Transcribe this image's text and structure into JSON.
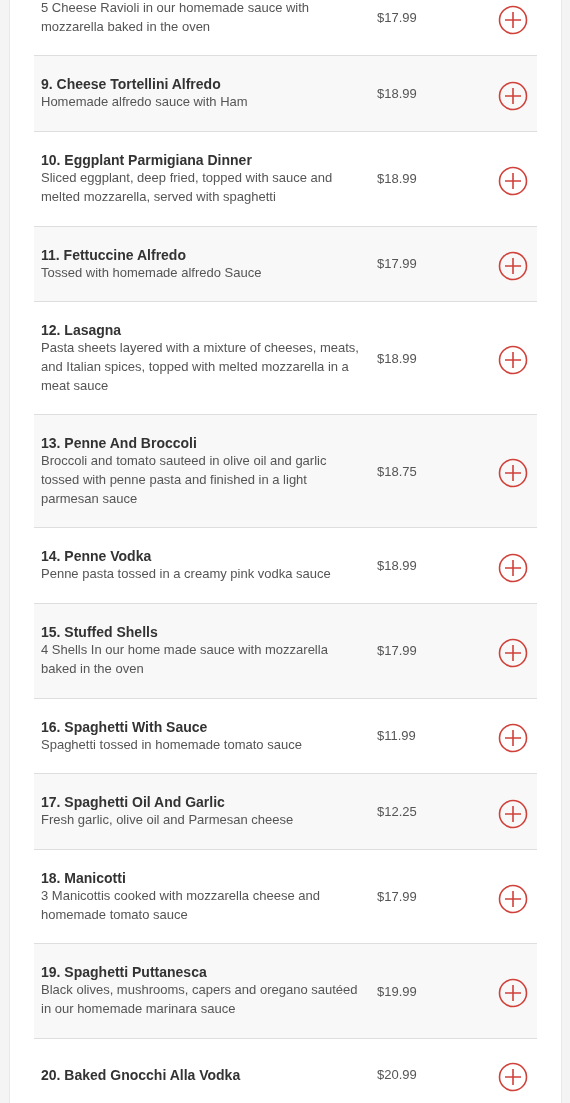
{
  "menu_items": [
    {
      "description": "5 Cheese Ravioli in our homemade sauce with mozzarella baked in the oven",
      "price": "$17.99"
    },
    {
      "name": "9. Cheese Tortellini Alfredo",
      "description": "Homemade alfredo sauce with Ham",
      "price": "$18.99"
    },
    {
      "name": "10. Eggplant Parmigiana Dinner",
      "description": "Sliced eggplant, deep fried, topped with sauce and melted mozzarella, served with spaghetti",
      "price": "$18.99"
    },
    {
      "name": "11. Fettuccine Alfredo",
      "description": "Tossed with homemade alfredo Sauce",
      "price": "$17.99"
    },
    {
      "name": "12. Lasagna",
      "description": "Pasta sheets layered with a mixture of cheeses, meats, and Italian spices, topped with melted mozzarella in a meat sauce",
      "price": "$18.99"
    },
    {
      "name": "13. Penne And Broccoli",
      "description": "Broccoli and tomato sauteed in olive oil and garlic tossed with penne pasta and finished in a light parmesan sauce",
      "price": "$18.75"
    },
    {
      "name": "14. Penne Vodka",
      "description": "Penne pasta tossed in a creamy pink vodka sauce",
      "price": "$18.99"
    },
    {
      "name": "15. Stuffed Shells",
      "description": "4 Shells In our home made sauce with mozzarella baked in the oven",
      "price": "$17.99"
    },
    {
      "name": "16. Spaghetti With Sauce",
      "description": "Spaghetti tossed in homemade tomato sauce",
      "price": "$11.99"
    },
    {
      "name": "17. Spaghetti Oil And Garlic",
      "description": "Fresh garlic, olive oil and Parmesan cheese",
      "price": "$12.25"
    },
    {
      "name": "18. Manicotti",
      "description": "3 Manicottis cooked with mozzarella cheese and homemade tomato sauce",
      "price": "$17.99"
    },
    {
      "name": "19. Spaghetti Puttanesca",
      "description": "Black olives, mushrooms, capers and oregano sautéed in our homemade marinara sauce",
      "price": "$19.99"
    },
    {
      "name": "20. Baked Gnocchi Alla Vodka",
      "price": "$20.99"
    }
  ]
}
